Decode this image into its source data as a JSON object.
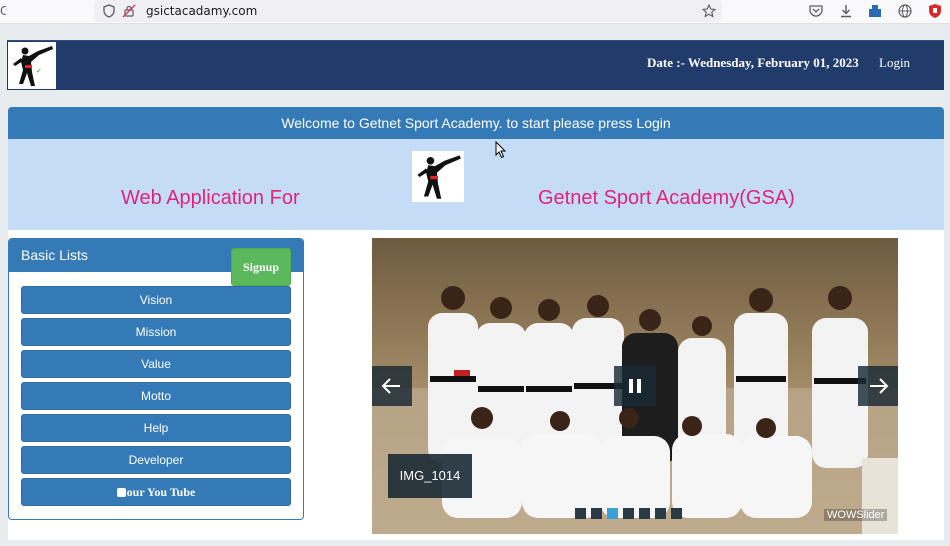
{
  "browser": {
    "url": "gsictacadamy.com",
    "reload_glyph": "C"
  },
  "header": {
    "date": "Date :- Wednesday, February 01, 2023",
    "login": "Login"
  },
  "welcome": "Welcome to Getnet Sport Academy. to start please press Login",
  "banner": {
    "left_text": "Web Application For",
    "right_text": "Getnet Sport Academy(GSA)"
  },
  "sidebar": {
    "title": "Basic Lists",
    "signup": "Signup",
    "items": [
      {
        "label": "Vision"
      },
      {
        "label": "Mission"
      },
      {
        "label": "Value"
      },
      {
        "label": "Motto"
      },
      {
        "label": "Help"
      },
      {
        "label": "Developer"
      },
      {
        "label": "our You Tube"
      }
    ]
  },
  "slider": {
    "caption": "IMG_1014",
    "watermark": "WOWSlider",
    "active_bullet": 3,
    "bullet_count": 7
  },
  "colors": {
    "header_bg": "#213c6b",
    "primary": "#337ab7",
    "banner_bg": "#c5dcf7",
    "banner_text": "#e2237a",
    "signup": "#5cb85c"
  }
}
